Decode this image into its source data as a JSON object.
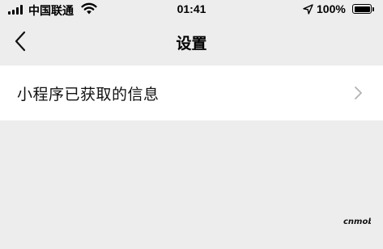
{
  "status_bar": {
    "carrier": "中国联通",
    "time": "01:41",
    "battery": "100%",
    "battery_level": 1.0,
    "signal_bars": 4
  },
  "nav": {
    "title": "设置",
    "back_icon": "chevron-left-icon"
  },
  "list": {
    "items": [
      {
        "label": "小程序已获取的信息",
        "icon": "chevron-right-icon"
      }
    ]
  },
  "watermark": {
    "text": "cnmob"
  },
  "colors": {
    "background": "#ededed",
    "cell_background": "#ffffff",
    "text": "#111111",
    "chevron": "#b2b2b2"
  }
}
